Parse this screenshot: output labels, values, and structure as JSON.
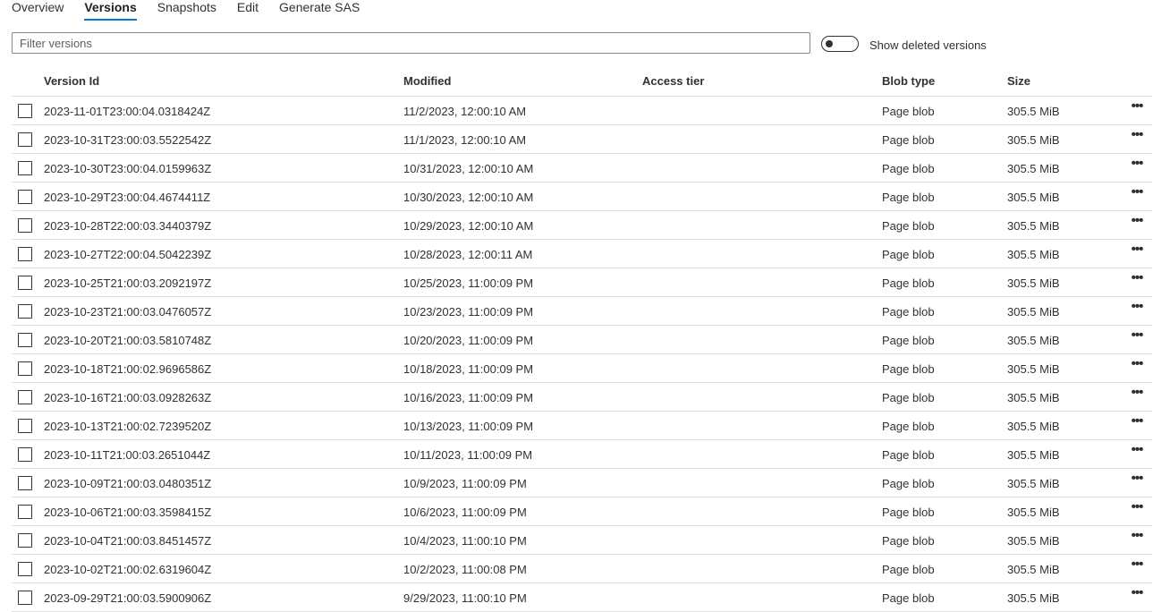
{
  "tabs": [
    {
      "label": "Overview",
      "active": false
    },
    {
      "label": "Versions",
      "active": true
    },
    {
      "label": "Snapshots",
      "active": false
    },
    {
      "label": "Edit",
      "active": false
    },
    {
      "label": "Generate SAS",
      "active": false
    }
  ],
  "filter": {
    "placeholder": "Filter versions",
    "value": ""
  },
  "toggle": {
    "label": "Show deleted versions",
    "on": false
  },
  "columns": {
    "version_id": "Version Id",
    "modified": "Modified",
    "access_tier": "Access tier",
    "blob_type": "Blob type",
    "size": "Size"
  },
  "row_actions_icon": "more-horizontal-icon",
  "rows": [
    {
      "version_id": "2023-11-01T23:00:04.0318424Z",
      "modified": "11/2/2023, 12:00:10 AM",
      "access_tier": "",
      "blob_type": "Page blob",
      "size": "305.5 MiB"
    },
    {
      "version_id": "2023-10-31T23:00:03.5522542Z",
      "modified": "11/1/2023, 12:00:10 AM",
      "access_tier": "",
      "blob_type": "Page blob",
      "size": "305.5 MiB"
    },
    {
      "version_id": "2023-10-30T23:00:04.0159963Z",
      "modified": "10/31/2023, 12:00:10 AM",
      "access_tier": "",
      "blob_type": "Page blob",
      "size": "305.5 MiB"
    },
    {
      "version_id": "2023-10-29T23:00:04.4674411Z",
      "modified": "10/30/2023, 12:00:10 AM",
      "access_tier": "",
      "blob_type": "Page blob",
      "size": "305.5 MiB"
    },
    {
      "version_id": "2023-10-28T22:00:03.3440379Z",
      "modified": "10/29/2023, 12:00:10 AM",
      "access_tier": "",
      "blob_type": "Page blob",
      "size": "305.5 MiB"
    },
    {
      "version_id": "2023-10-27T22:00:04.5042239Z",
      "modified": "10/28/2023, 12:00:11 AM",
      "access_tier": "",
      "blob_type": "Page blob",
      "size": "305.5 MiB"
    },
    {
      "version_id": "2023-10-25T21:00:03.2092197Z",
      "modified": "10/25/2023, 11:00:09 PM",
      "access_tier": "",
      "blob_type": "Page blob",
      "size": "305.5 MiB"
    },
    {
      "version_id": "2023-10-23T21:00:03.0476057Z",
      "modified": "10/23/2023, 11:00:09 PM",
      "access_tier": "",
      "blob_type": "Page blob",
      "size": "305.5 MiB"
    },
    {
      "version_id": "2023-10-20T21:00:03.5810748Z",
      "modified": "10/20/2023, 11:00:09 PM",
      "access_tier": "",
      "blob_type": "Page blob",
      "size": "305.5 MiB"
    },
    {
      "version_id": "2023-10-18T21:00:02.9696586Z",
      "modified": "10/18/2023, 11:00:09 PM",
      "access_tier": "",
      "blob_type": "Page blob",
      "size": "305.5 MiB"
    },
    {
      "version_id": "2023-10-16T21:00:03.0928263Z",
      "modified": "10/16/2023, 11:00:09 PM",
      "access_tier": "",
      "blob_type": "Page blob",
      "size": "305.5 MiB"
    },
    {
      "version_id": "2023-10-13T21:00:02.7239520Z",
      "modified": "10/13/2023, 11:00:09 PM",
      "access_tier": "",
      "blob_type": "Page blob",
      "size": "305.5 MiB"
    },
    {
      "version_id": "2023-10-11T21:00:03.2651044Z",
      "modified": "10/11/2023, 11:00:09 PM",
      "access_tier": "",
      "blob_type": "Page blob",
      "size": "305.5 MiB"
    },
    {
      "version_id": "2023-10-09T21:00:03.0480351Z",
      "modified": "10/9/2023, 11:00:09 PM",
      "access_tier": "",
      "blob_type": "Page blob",
      "size": "305.5 MiB"
    },
    {
      "version_id": "2023-10-06T21:00:03.3598415Z",
      "modified": "10/6/2023, 11:00:09 PM",
      "access_tier": "",
      "blob_type": "Page blob",
      "size": "305.5 MiB"
    },
    {
      "version_id": "2023-10-04T21:00:03.8451457Z",
      "modified": "10/4/2023, 11:00:10 PM",
      "access_tier": "",
      "blob_type": "Page blob",
      "size": "305.5 MiB"
    },
    {
      "version_id": "2023-10-02T21:00:02.6319604Z",
      "modified": "10/2/2023, 11:00:08 PM",
      "access_tier": "",
      "blob_type": "Page blob",
      "size": "305.5 MiB"
    },
    {
      "version_id": "2023-09-29T21:00:03.5900906Z",
      "modified": "9/29/2023, 11:00:10 PM",
      "access_tier": "",
      "blob_type": "Page blob",
      "size": "305.5 MiB"
    }
  ]
}
